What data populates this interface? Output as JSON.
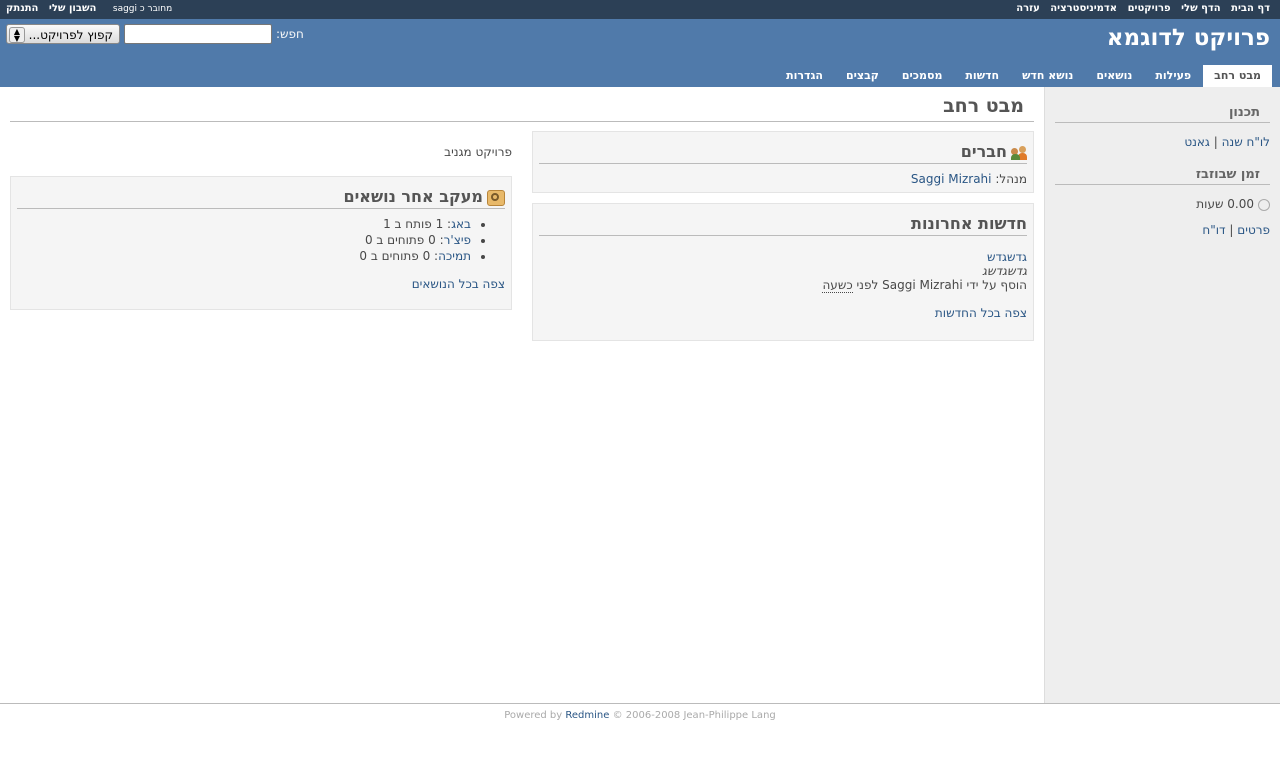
{
  "top_menu": {
    "right_items": [
      "דף הבית",
      "הדף שלי",
      "פרויקטים",
      "אדמיניסטרציה",
      "עזרה"
    ],
    "logged_as": "מחובר כ saggi",
    "my_account": "השבון שלי",
    "logout": "התנתק"
  },
  "header": {
    "title": "פרויקט לדוגמא",
    "search_label": "חפש:",
    "search_value": "",
    "jump_select": "קפוץ לפרויקט..."
  },
  "main_menu": [
    "מבט רחב",
    "פעילות",
    "נושאים",
    "נושא חדש",
    "חדשות",
    "מסמכים",
    "קבצים",
    "הגדרות"
  ],
  "sidebar": {
    "planning_title": "תכנון",
    "calendar": "לו\"ח שנה",
    "separator": "|",
    "gantt": "גאנט",
    "spent_time_title": "זמן שבוזבז",
    "hours": "0.00 שעות",
    "details": "פרטים",
    "report": "דו\"ח"
  },
  "content": {
    "title": "מבט רחב",
    "description": "פרויקט מגניב",
    "members": {
      "title": "חברים",
      "manager_label": "מנהל:",
      "manager_name": "Saggi Mizrahi"
    },
    "news": {
      "title": "חדשות אחרונות",
      "item_title": "גדשגדש",
      "item_summary": "גדשגדשג",
      "added_by_prefix": "הוסף על ידי",
      "author": "Saggi Mizrahi",
      "before": "לפני",
      "time": "כשעה",
      "view_all": "צפה בכל החדשות"
    },
    "tracking": {
      "title": "מעקב אחר נושאים",
      "trackers": [
        {
          "name": "באג",
          "text": ": 1 פותח ב 1"
        },
        {
          "name": "פיצ'ר",
          "text": ": 0 פתוחים ב 0"
        },
        {
          "name": "תמיכה",
          "text": ": 0 פתוחים ב 0"
        }
      ],
      "view_all": "צפה בכל הנושאים"
    }
  },
  "footer": {
    "powered_by": "Powered by",
    "redmine": "Redmine",
    "copyright": "© 2006-2008 Jean-Philippe Lang"
  }
}
